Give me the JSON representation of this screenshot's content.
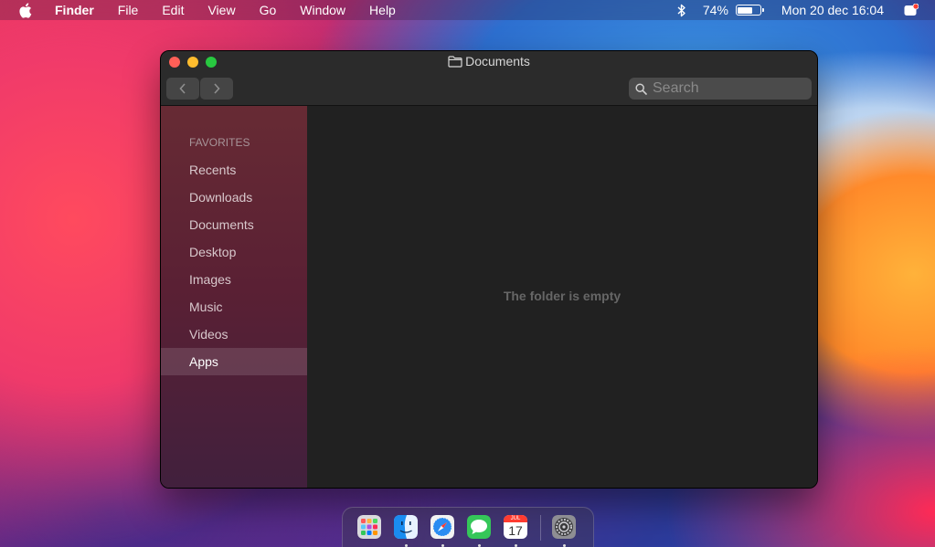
{
  "menubar": {
    "app_name": "Finder",
    "menus": [
      "File",
      "Edit",
      "View",
      "Go",
      "Window",
      "Help"
    ],
    "battery_percent": "74%",
    "battery_level": 0.74,
    "datetime": "Mon 20 dec 16:04"
  },
  "window": {
    "title": "Documents",
    "search_placeholder": "Search",
    "sidebar": {
      "section": "FAVORITES",
      "items": [
        "Recents",
        "Downloads",
        "Documents",
        "Desktop",
        "Images",
        "Music",
        "Videos",
        "Apps"
      ],
      "active": "Apps"
    },
    "empty_message": "The folder is empty"
  },
  "dock": {
    "apps": [
      "launchpad",
      "finder",
      "safari",
      "messages",
      "calendar",
      "system-preferences"
    ],
    "calendar": {
      "month": "JUL",
      "day": "17"
    }
  },
  "colors": {
    "close": "#ff5f57",
    "minimize": "#febc2e",
    "maximize": "#28c840"
  }
}
